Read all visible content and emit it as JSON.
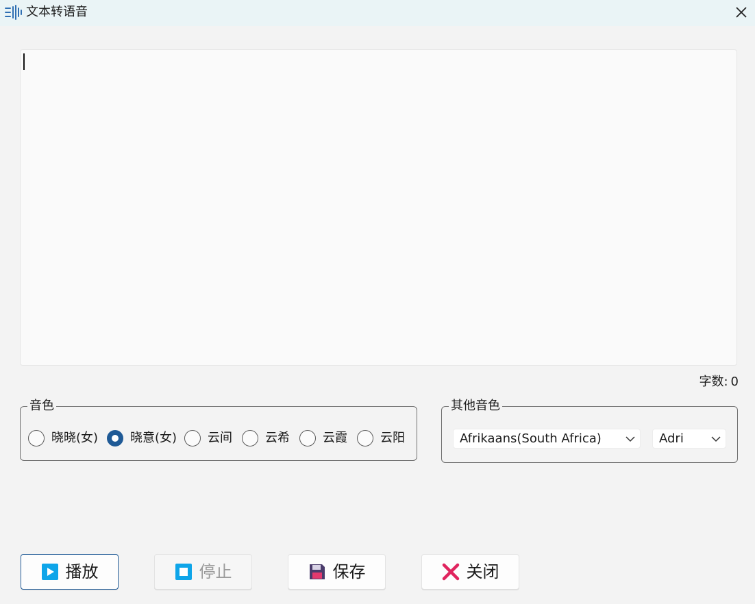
{
  "window": {
    "title": "文本转语音",
    "app_icon": "audio-wave-icon",
    "close_icon": "close-icon"
  },
  "editor": {
    "value": ""
  },
  "counter": {
    "label": "字数:",
    "value": "0"
  },
  "voice_group": {
    "legend": "音色",
    "options": [
      {
        "label": "晓晓(女)",
        "checked": false
      },
      {
        "label": "晓意(女)",
        "checked": true
      },
      {
        "label": "云间",
        "checked": false
      },
      {
        "label": "云希",
        "checked": false
      },
      {
        "label": "云霞",
        "checked": false
      },
      {
        "label": "云阳",
        "checked": false
      }
    ]
  },
  "other_voice_group": {
    "legend": "其他音色",
    "language": "Afrikaans(South Africa)",
    "voice": "Adri"
  },
  "buttons": {
    "play": {
      "label": "播放",
      "icon": "play-icon",
      "color": "#0ea5e9"
    },
    "stop": {
      "label": "停止",
      "icon": "stop-icon",
      "color": "#0ea5e9",
      "disabled": true
    },
    "save": {
      "label": "保存",
      "icon": "floppy-disk-icon",
      "color": "#4a3b6b"
    },
    "close": {
      "label": "关闭",
      "icon": "x-icon",
      "color": "#e0245e"
    }
  },
  "colors": {
    "accent": "#1f5a96",
    "titlebar": "#eaf4f6"
  }
}
